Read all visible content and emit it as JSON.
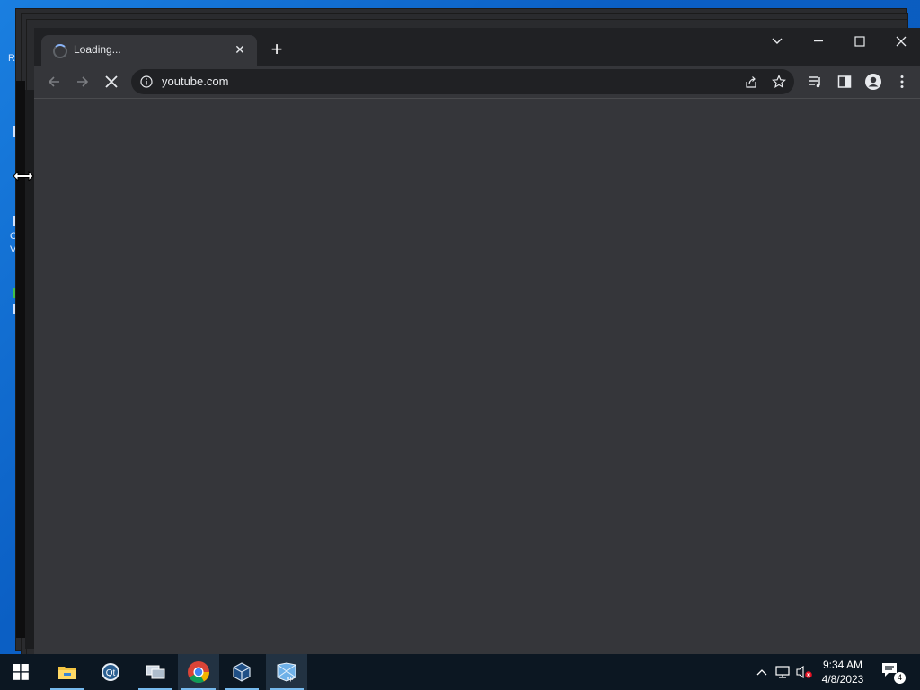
{
  "desktop": {
    "side_glyphs": [
      "R",
      "C",
      "V"
    ]
  },
  "browser": {
    "tab": {
      "title": "Loading...",
      "close_label": "✕"
    },
    "new_tab_label": "+",
    "address": {
      "url": "youtube.com"
    },
    "colors": {
      "frame": "#202124",
      "toolbar": "#35363a",
      "omnibox": "#202124",
      "accent": "#8ab4f8"
    }
  },
  "taskbar": {
    "apps": [
      {
        "name": "start-button"
      },
      {
        "name": "file-explorer"
      },
      {
        "name": "qt-creator"
      },
      {
        "name": "network-app"
      },
      {
        "name": "chrome"
      },
      {
        "name": "virtualbox"
      },
      {
        "name": "windows-xp-vm"
      }
    ],
    "clock": {
      "time": "9:34 AM",
      "date": "4/8/2023"
    },
    "notifications_count": "4"
  }
}
